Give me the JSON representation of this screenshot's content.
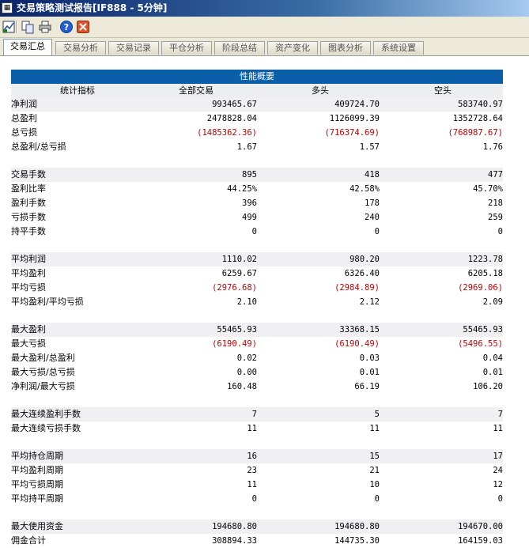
{
  "window": {
    "title": "交易策略测试报告[IF888 - 5分钟]",
    "app_icon": "spreadsheet-app-icon"
  },
  "toolbar": {
    "buttons": [
      {
        "name": "save-report-button",
        "icon": "chart-save-icon"
      },
      {
        "name": "copy-button",
        "icon": "copy-icon"
      },
      {
        "name": "print-button",
        "icon": "printer-icon"
      },
      {
        "name": "help-button",
        "icon": "help-icon"
      },
      {
        "name": "close-button",
        "icon": "close-icon"
      }
    ]
  },
  "tabs": [
    {
      "label": "交易汇总",
      "active": true
    },
    {
      "label": "交易分析",
      "active": false
    },
    {
      "label": "交易记录",
      "active": false
    },
    {
      "label": "平仓分析",
      "active": false
    },
    {
      "label": "阶段总结",
      "active": false
    },
    {
      "label": "资产变化",
      "active": false
    },
    {
      "label": "图表分析",
      "active": false
    },
    {
      "label": "系统设置",
      "active": false
    }
  ],
  "report": {
    "section_title": "性能概要",
    "columns": [
      "统计指标",
      "全部交易",
      "多头",
      "空头"
    ],
    "groups": [
      [
        {
          "label": "净利润",
          "values": [
            "993465.67",
            "409724.70",
            "583740.97"
          ]
        },
        {
          "label": "总盈利",
          "values": [
            "2478828.04",
            "1126099.39",
            "1352728.64"
          ]
        },
        {
          "label": "总亏损",
          "values": [
            "(1485362.36)",
            "(716374.69)",
            "(768987.67)"
          ],
          "negative": true
        },
        {
          "label": "总盈利/总亏损",
          "values": [
            "1.67",
            "1.57",
            "1.76"
          ]
        }
      ],
      [
        {
          "label": "交易手数",
          "values": [
            "895",
            "418",
            "477"
          ]
        },
        {
          "label": "盈利比率",
          "values": [
            "44.25%",
            "42.58%",
            "45.70%"
          ]
        },
        {
          "label": "盈利手数",
          "values": [
            "396",
            "178",
            "218"
          ]
        },
        {
          "label": "亏损手数",
          "values": [
            "499",
            "240",
            "259"
          ]
        },
        {
          "label": "持平手数",
          "values": [
            "0",
            "0",
            "0"
          ]
        }
      ],
      [
        {
          "label": "平均利润",
          "values": [
            "1110.02",
            "980.20",
            "1223.78"
          ]
        },
        {
          "label": "平均盈利",
          "values": [
            "6259.67",
            "6326.40",
            "6205.18"
          ]
        },
        {
          "label": "平均亏损",
          "values": [
            "(2976.68)",
            "(2984.89)",
            "(2969.06)"
          ],
          "negative": true
        },
        {
          "label": "平均盈利/平均亏损",
          "values": [
            "2.10",
            "2.12",
            "2.09"
          ]
        }
      ],
      [
        {
          "label": "最大盈利",
          "values": [
            "55465.93",
            "33368.15",
            "55465.93"
          ]
        },
        {
          "label": "最大亏损",
          "values": [
            "(6190.49)",
            "(6190.49)",
            "(5496.55)"
          ],
          "negative": true
        },
        {
          "label": "最大盈利/总盈利",
          "values": [
            "0.02",
            "0.03",
            "0.04"
          ]
        },
        {
          "label": "最大亏损/总亏损",
          "values": [
            "0.00",
            "0.01",
            "0.01"
          ]
        },
        {
          "label": "净利润/最大亏损",
          "values": [
            "160.48",
            "66.19",
            "106.20"
          ]
        }
      ],
      [
        {
          "label": "最大连续盈利手数",
          "values": [
            "7",
            "5",
            "7"
          ]
        },
        {
          "label": "最大连续亏损手数",
          "values": [
            "11",
            "11",
            "11"
          ]
        }
      ],
      [
        {
          "label": "平均持仓周期",
          "values": [
            "16",
            "15",
            "17"
          ]
        },
        {
          "label": "平均盈利周期",
          "values": [
            "23",
            "21",
            "24"
          ]
        },
        {
          "label": "平均亏损周期",
          "values": [
            "11",
            "10",
            "12"
          ]
        },
        {
          "label": "平均持平周期",
          "values": [
            "0",
            "0",
            "0"
          ]
        }
      ],
      [
        {
          "label": "最大使用资金",
          "values": [
            "194680.80",
            "194680.80",
            "194670.00"
          ]
        },
        {
          "label": "佣金合计",
          "values": [
            "308894.33",
            "144735.30",
            "164159.03"
          ]
        }
      ]
    ]
  },
  "colors": {
    "header_bg": "#0b5ea8",
    "negative_text": "#c00000",
    "row_shade": "#f0f0f2"
  }
}
